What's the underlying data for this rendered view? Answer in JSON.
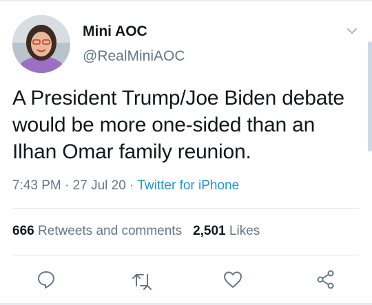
{
  "user": {
    "display_name": "Mini AOC",
    "handle": "@RealMiniAOC"
  },
  "tweet": {
    "text": "A President Trump/Joe Biden debate would be more one-sided than an Ilhan Omar family reunion.",
    "time": "7:43 PM",
    "separator": " · ",
    "date": "27 Jul 20",
    "source": "Twitter for iPhone"
  },
  "stats": {
    "retweets_count": "666",
    "retweets_label": "Retweets and comments",
    "likes_count": "2,501",
    "likes_label": "Likes"
  },
  "icons": {
    "caret": "chevron-down-icon",
    "reply": "reply-icon",
    "retweet": "retweet-icon",
    "like": "heart-icon",
    "share": "share-icon"
  },
  "colors": {
    "text": "#14171a",
    "secondary": "#657786",
    "link": "#1b95e0",
    "icon": "#657786"
  }
}
